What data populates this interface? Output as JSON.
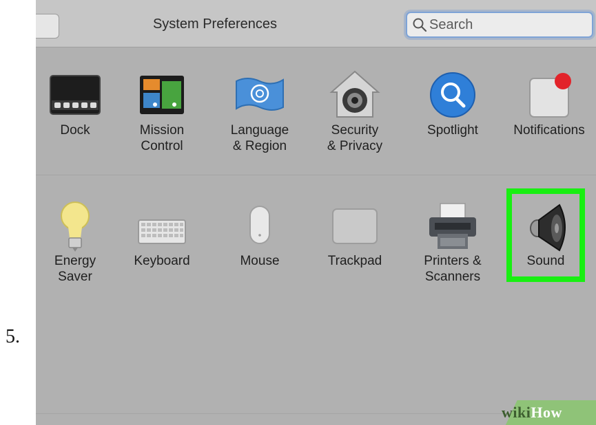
{
  "step_number": "5.",
  "window": {
    "title": "System Preferences",
    "search": {
      "placeholder": "Search",
      "value": ""
    }
  },
  "row1": [
    {
      "name": "dock",
      "label": "Dock",
      "icon": "dock-icon"
    },
    {
      "name": "mission-control",
      "label": "Mission\nControl",
      "icon": "mission-control-icon"
    },
    {
      "name": "language-region",
      "label": "Language\n& Region",
      "icon": "flag-icon"
    },
    {
      "name": "security-privacy",
      "label": "Security\n& Privacy",
      "icon": "house-lock-icon"
    },
    {
      "name": "spotlight",
      "label": "Spotlight",
      "icon": "magnifier-icon"
    },
    {
      "name": "notifications",
      "label": "Notifications",
      "icon": "notification-badge-icon"
    }
  ],
  "row2": [
    {
      "name": "energy-saver",
      "label": "Energy\nSaver",
      "icon": "light-bulb-icon"
    },
    {
      "name": "keyboard",
      "label": "Keyboard",
      "icon": "keyboard-icon"
    },
    {
      "name": "mouse",
      "label": "Mouse",
      "icon": "mouse-icon"
    },
    {
      "name": "trackpad",
      "label": "Trackpad",
      "icon": "trackpad-icon"
    },
    {
      "name": "printers-scanners",
      "label": "Printers &\nScanners",
      "icon": "printer-icon"
    },
    {
      "name": "sound",
      "label": "Sound",
      "icon": "speaker-icon"
    }
  ],
  "highlight": {
    "target": "sound",
    "color": "#18ef12"
  },
  "watermark": {
    "part1": "wiki",
    "part2": "How"
  }
}
